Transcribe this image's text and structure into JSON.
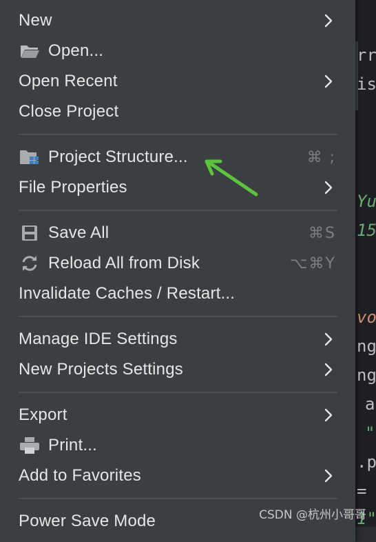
{
  "menu": {
    "items": [
      {
        "label": "New"
      },
      {
        "label": "Open...",
        "icon": "folder-open-icon"
      },
      {
        "label": "Open Recent"
      },
      {
        "label": "Close Project"
      },
      {
        "label": "Project Structure...",
        "icon": "project-structure-icon",
        "shortcut": "⌘ ;"
      },
      {
        "label": "File Properties"
      },
      {
        "label": "Save All",
        "icon": "save-icon",
        "shortcut": "⌘S"
      },
      {
        "label": "Reload All from Disk",
        "icon": "reload-icon",
        "shortcut": "⌥⌘Y"
      },
      {
        "label": "Invalidate Caches / Restart..."
      },
      {
        "label": "Manage IDE Settings"
      },
      {
        "label": "New Projects Settings"
      },
      {
        "label": "Export"
      },
      {
        "label": "Print...",
        "icon": "printer-icon"
      },
      {
        "label": "Add to Favorites"
      },
      {
        "label": "Power Save Mode"
      }
    ]
  },
  "editor": {
    "lines": [
      "rr",
      "is",
      "Yu",
      "15",
      "vo",
      "ng",
      "ng",
      "a",
      "\"",
      ".p",
      "=",
      "1\""
    ]
  },
  "watermark": "CSDN @杭州小哥哥",
  "colors": {
    "menu_bg": "#3c3f41",
    "text": "#e6e6e6",
    "shortcut": "#7d7f82",
    "annotation_arrow": "#5dc33f"
  }
}
